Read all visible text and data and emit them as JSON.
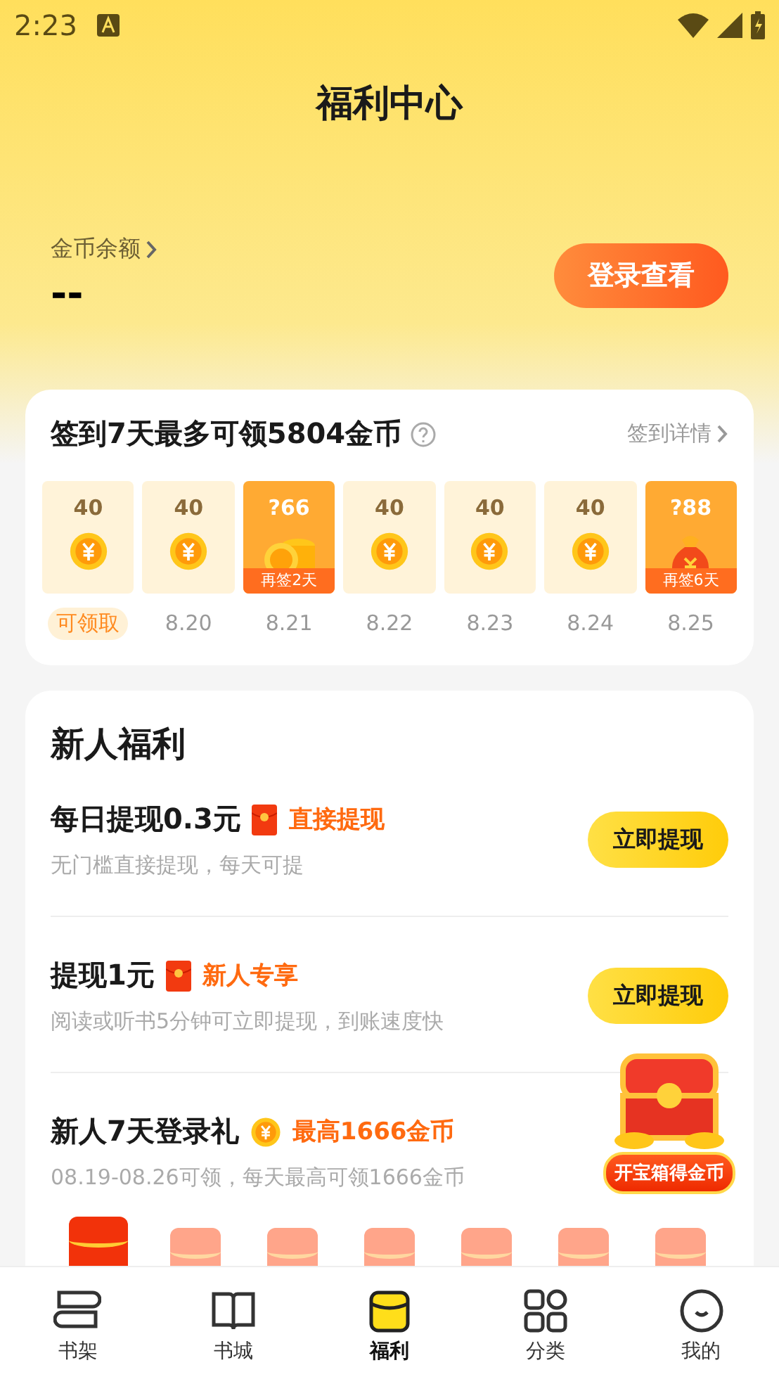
{
  "status_bar": {
    "time": "2:23"
  },
  "header": {
    "title": "福利中心"
  },
  "balance": {
    "label": "金币余额",
    "value": "--",
    "button": "登录查看"
  },
  "signin": {
    "title": "签到7天最多可领5804金币",
    "detail": "签到详情",
    "days": [
      {
        "amount": "40",
        "kind": "coin",
        "label": "可领取",
        "claimable": true
      },
      {
        "amount": "40",
        "kind": "coin",
        "label": "8.20",
        "claimable": false
      },
      {
        "amount": "?66",
        "kind": "coins",
        "tag": "再签2天",
        "label": "8.21",
        "claimable": false
      },
      {
        "amount": "40",
        "kind": "coin",
        "label": "8.22",
        "claimable": false
      },
      {
        "amount": "40",
        "kind": "coin",
        "label": "8.23",
        "claimable": false
      },
      {
        "amount": "40",
        "kind": "coin",
        "label": "8.24",
        "claimable": false
      },
      {
        "amount": "?88",
        "kind": "bag",
        "tag": "再签6天",
        "label": "8.25",
        "claimable": false
      }
    ]
  },
  "newcomer": {
    "title": "新人福利",
    "tasks": [
      {
        "title": "每日提现0.3元",
        "kind": "envelope",
        "badge": "直接提现",
        "desc": "无门槛直接提现，每天可提",
        "button": "立即提现"
      },
      {
        "title": "提现1元",
        "kind": "envelope",
        "badge": "新人专享",
        "desc": "阅读或听书5分钟可立即提现，到账速度快",
        "button": "立即提现"
      },
      {
        "title": "新人7天登录礼",
        "kind": "coin",
        "badge": "最高1666金币",
        "desc": "08.19-08.26可领，每天最高可领1666金币"
      }
    ],
    "chest": {
      "label": "开宝箱得金币"
    },
    "envelopes": [
      {
        "active": true
      },
      {
        "active": false
      },
      {
        "active": false
      },
      {
        "active": false
      },
      {
        "active": false
      },
      {
        "active": false
      },
      {
        "active": false
      }
    ]
  },
  "tabs": [
    {
      "label": "书架",
      "kind": "shelf",
      "selected": false
    },
    {
      "label": "书城",
      "kind": "book",
      "selected": false
    },
    {
      "label": "福利",
      "kind": "welfare",
      "selected": true
    },
    {
      "label": "分类",
      "kind": "grid",
      "selected": false
    },
    {
      "label": "我的",
      "kind": "face",
      "selected": false
    }
  ]
}
